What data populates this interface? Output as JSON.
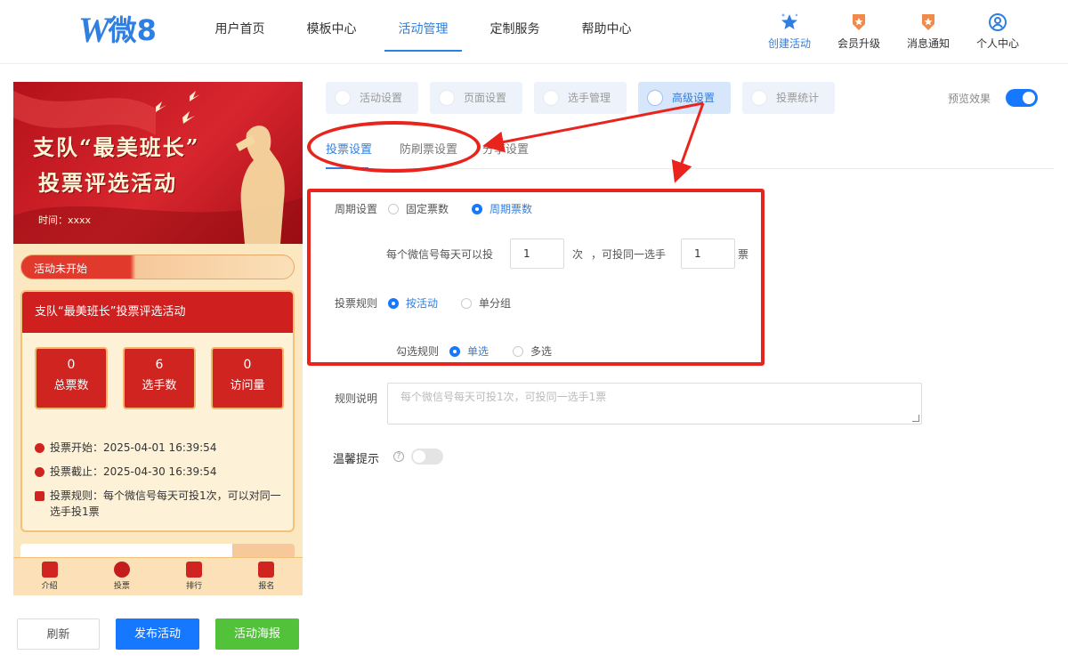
{
  "logo": {
    "mark": "W",
    "text": "微8"
  },
  "nav": [
    {
      "label": "用户首页"
    },
    {
      "label": "模板中心"
    },
    {
      "label": "活动管理"
    },
    {
      "label": "定制服务"
    },
    {
      "label": "帮助中心"
    }
  ],
  "header_actions": [
    {
      "label": "创建活动",
      "icon": "star-sparkle-icon"
    },
    {
      "label": "会员升级",
      "icon": "member-badge-icon"
    },
    {
      "label": "消息通知",
      "icon": "notification-badge-icon"
    },
    {
      "label": "个人中心",
      "icon": "user-circle-icon"
    }
  ],
  "preview": {
    "banner_title_line1": "支队“最美班长”",
    "banner_title_line2": "投票评选活动",
    "banner_time": "时间：xxxx",
    "status": "活动未开始",
    "activity_title": "支队“最美班长”投票评选活动",
    "stats": [
      {
        "value": "0",
        "label": "总票数"
      },
      {
        "value": "6",
        "label": "选手数"
      },
      {
        "value": "0",
        "label": "访问量"
      }
    ],
    "info": [
      {
        "text": "投票开始：2025-04-01 16:39:54"
      },
      {
        "text": "投票截止：2025-04-30 16:39:54"
      },
      {
        "text": "投票规则：每个微信号每天可投1次，可以对同一选手投1票"
      }
    ],
    "tabbar": [
      {
        "label": "介绍"
      },
      {
        "label": "投票"
      },
      {
        "label": "排行"
      },
      {
        "label": "报名"
      }
    ]
  },
  "buttons": {
    "refresh": "刷新",
    "publish": "发布活动",
    "poster": "活动海报"
  },
  "subtabs": [
    {
      "label": "活动设置"
    },
    {
      "label": "页面设置"
    },
    {
      "label": "选手管理"
    },
    {
      "label": "高级设置"
    },
    {
      "label": "投票统计"
    }
  ],
  "preview_toggle": {
    "label": "预览效果",
    "on": true
  },
  "inner_tabs": [
    {
      "label": "投票设置"
    },
    {
      "label": "防刷票设置"
    },
    {
      "label": "分享设置"
    }
  ],
  "form": {
    "period_label": "周期设置",
    "period_options": [
      "固定票数",
      "周期票数"
    ],
    "period_selected": "周期票数",
    "daily_prefix": "每个微信号每天可以投",
    "daily_value": "1",
    "daily_unit": "次",
    "same_player_text": "，可投同一选手",
    "same_player_value": "1",
    "same_player_unit": "票",
    "rule_label": "投票规则",
    "rule_options": [
      "按活动",
      "单分组"
    ],
    "rule_selected": "按活动",
    "check_label": "勾选规则",
    "check_options": [
      "单选",
      "多选"
    ],
    "check_selected": "单选",
    "desc_label": "规则说明",
    "desc_placeholder": "每个微信号每天可投1次，可投同一选手1票",
    "tip_label": "温馨提示",
    "tip_help": "?",
    "tip_on": false
  },
  "colors": {
    "accent": "#1677ff",
    "annotation": "#e8241c",
    "publish": "#1677ff",
    "poster": "#52c23a"
  }
}
